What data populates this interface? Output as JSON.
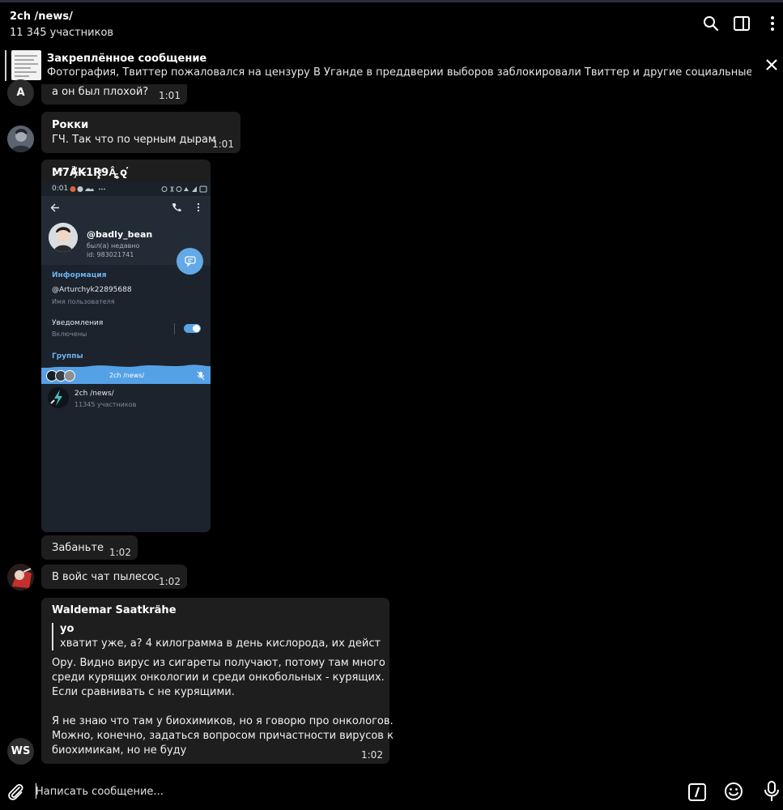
{
  "header": {
    "title": "2ch /news/",
    "subtitle": "11 345 участников",
    "icons": [
      "search-icon",
      "sidebar-panel-icon",
      "more-vertical-icon"
    ]
  },
  "pinned": {
    "title": "Закреплённое сообщение",
    "text": "Фотография, Твиттер пожаловался на цензуру  В Уганде в преддверии выборов заблокировали Твиттер и другие социальные сети.  И не…"
  },
  "messages": [
    {
      "avatar": "A",
      "text": "а он был плохой?",
      "time": "1:01"
    },
    {
      "sender": "Рокки",
      "text": "ГЧ. Так что по черным дырам",
      "time": "1:01"
    },
    {
      "sender": "M̸̛7Â̴̧͌K̴1R̴̨̛͓͈9Â̵̫̫̯̠̟̟̠̗̙̻̝̤͙̦̰̟ ̭̘̗̟̩̳̠o̢̕",
      "screenshot": {
        "status_time": "0:01",
        "username": "@badly_bean",
        "last_seen": "был(а) недавно",
        "user_id": "id: 983021741",
        "info_section": "Информация",
        "handle": "@Arturchyk22895688",
        "handle_label": "Имя пользователя",
        "notifications_label": "Уведомления",
        "notifications_state": "Включены",
        "groups_section": "Группы",
        "voice_chat_title": "2ch /news/",
        "group_name": "2ch /news/",
        "group_members": "11345 участников"
      }
    },
    {
      "text": "Забаньте",
      "time": "1:02"
    },
    {
      "text": "В войс чат пылесос",
      "time": "1:02"
    },
    {
      "avatar": "WS",
      "sender": "Waldemar Saatkrähe",
      "reply_to": {
        "author": "yo",
        "text": "хватит уже, а? 4 килограмма в день кислорода, их действие н…"
      },
      "lines": [
        "Ору. Видно вирус из сигареты получают, потому там много",
        "среди курящих онкологии и среди онкобольных - курящих.",
        "Если сравнивать с не курящими.",
        "",
        "Я не знаю что там у биохимиков, но я говорю про онкологов.",
        "Можно, конечно, задаться вопросом причастности вирусов к",
        "биохимикам, но не буду"
      ],
      "time": "1:02"
    }
  ],
  "composer": {
    "placeholder": "Написать сообщение...",
    "icons": [
      "attach-icon",
      "bot-commands-icon",
      "emoji-icon",
      "microphone-icon"
    ]
  },
  "colors": {
    "background": "#000000",
    "bubble": "#1e1e1e",
    "accent": "#62a9e6"
  }
}
